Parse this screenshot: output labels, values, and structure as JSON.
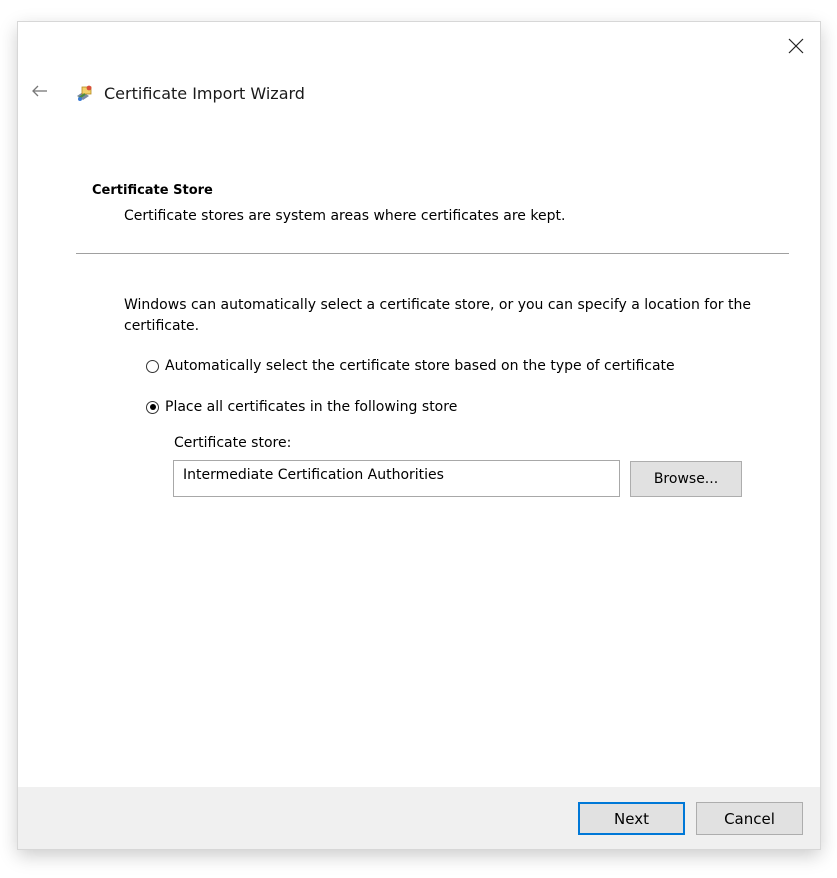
{
  "window": {
    "title": "Certificate Import Wizard",
    "back_icon": "back-arrow-icon",
    "close_icon": "close-icon",
    "wizard_icon": "certificate-wizard-icon"
  },
  "section": {
    "title": "Certificate Store",
    "description": "Certificate stores are system areas where certificates are kept."
  },
  "intro_text": "Windows can automatically select a certificate store, or you can specify a location for the certificate.",
  "options": {
    "auto": {
      "label": "Automatically select the certificate store based on the type of certificate",
      "selected": false
    },
    "manual": {
      "label": "Place all certificates in the following store",
      "selected": true
    }
  },
  "store": {
    "label": "Certificate store:",
    "value": "Intermediate Certification Authorities",
    "browse_label": "Browse..."
  },
  "footer": {
    "next_label": "Next",
    "cancel_label": "Cancel"
  },
  "colors": {
    "accent": "#0078d7",
    "footer_bg": "#f0f0f0",
    "button_bg": "#e1e1e1"
  }
}
